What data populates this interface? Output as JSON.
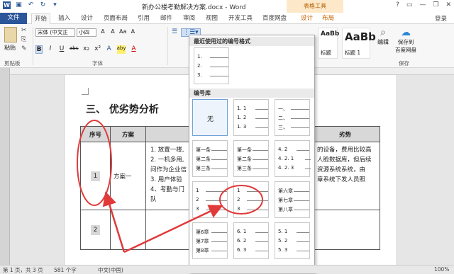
{
  "window": {
    "title": "新办公楼考勤解决方案.docx - Word",
    "context_tab_header": "表格工具",
    "login": "登录",
    "window_controls": [
      "?",
      "▭",
      "—",
      "❐",
      "✕"
    ]
  },
  "tabs": [
    "文件",
    "开始",
    "插入",
    "设计",
    "页面布局",
    "引用",
    "邮件",
    "审阅",
    "视图",
    "开发工具",
    "百度网盘",
    "设计",
    "布局"
  ],
  "ribbon": {
    "paste_label": "粘贴",
    "clipboard_group": "剪贴板",
    "font_name": "宋体 (中文正文)",
    "font_size": "小四",
    "font_group": "字体",
    "style_sample_text": "AaBb",
    "style_sample_label": "标题 1",
    "style_sample2_text": "AaBb",
    "style_sample2_label": "标题",
    "edit_label": "编辑",
    "save_label_1": "保存到",
    "save_label_2": "百度网盘",
    "save_group": "保存",
    "format_row1": [
      "A",
      "A",
      "Aa",
      "A"
    ],
    "format_row2": [
      "B",
      "I",
      "U",
      "abc",
      "x₂",
      "x²",
      "A",
      "aby",
      "A"
    ]
  },
  "document": {
    "heading": "三、   优劣势分析",
    "table_headers": [
      "序号",
      "方案",
      "劣势"
    ],
    "row1_num": "1",
    "row1_plan": "方案一",
    "row1_list": [
      "1. 放置一楼,",
      "2. 一机多用,",
      "问作为企业信",
      "3. 用户体验",
      "4、考勤与门",
      "队"
    ],
    "row1_right": [
      "的设备，费用比较高",
      "人脸数据库，但后续",
      "资源系统系统，由",
      "章系统下发人员照"
    ],
    "row2_num": "2"
  },
  "numbering_dropdown": {
    "recent_title": "最近使用过的编号格式",
    "library_title": "编号库",
    "none_label": "无",
    "tiles": [
      [
        "1.",
        "2.",
        "3."
      ],
      [
        "1. 1",
        "1. 2",
        "1. 3"
      ],
      [
        "一、",
        "二、",
        "三、"
      ],
      [
        "第一条",
        "第二条",
        "第三条"
      ],
      [
        "第一条",
        "第二条",
        "第三条"
      ],
      [
        "4. 2",
        "4. 2. 1",
        "4. 2. 3"
      ],
      [
        "1",
        "2",
        "3"
      ],
      [
        "1",
        "2",
        "3"
      ],
      [
        "第六章",
        "第七章",
        "第八章"
      ],
      [
        "第6章",
        "第7章",
        "第8章"
      ],
      [
        "6. 1",
        "6. 2",
        "6. 3"
      ],
      [
        "5. 1",
        "5. 2",
        "5. 3"
      ]
    ]
  },
  "status_bar": {
    "page": "第 1 页，共 3 页",
    "words": "581 个字",
    "language": "中文(中国)",
    "zoom": "100%"
  },
  "colors": {
    "word_blue": "#2b579a",
    "annotation_red": "#e03a3a",
    "context_orange": "#c86400"
  }
}
